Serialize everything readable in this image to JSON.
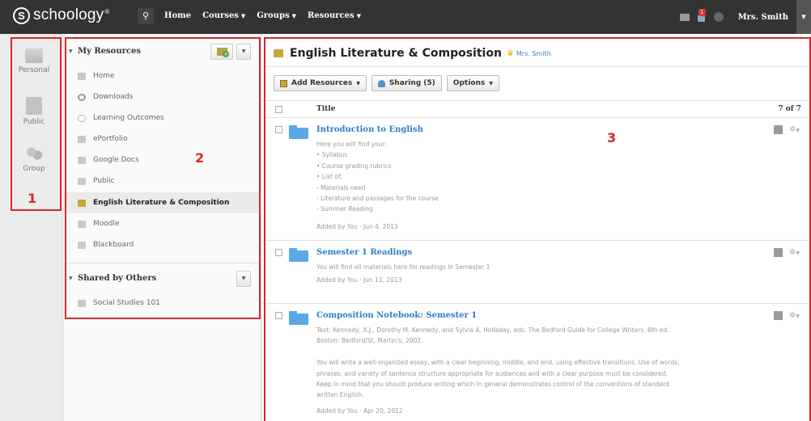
{
  "app": {
    "logo_letter": "S",
    "logo_text": "schoology",
    "logo_mark": "®"
  },
  "nav": {
    "items": [
      {
        "label": "Home",
        "has_caret": false
      },
      {
        "label": "Courses",
        "has_caret": true
      },
      {
        "label": "Groups",
        "has_caret": true
      },
      {
        "label": "Resources",
        "has_caret": true
      }
    ],
    "notification_count": "1",
    "user_name": "Mrs. Smith"
  },
  "categories": [
    {
      "label": "Personal",
      "icon": "personal-icon"
    },
    {
      "label": "Public",
      "icon": "public-icon"
    },
    {
      "label": "Group",
      "icon": "group-icon"
    }
  ],
  "tree": {
    "my_resources_title": "My Resources",
    "shared_title": "Shared by Others",
    "items": [
      {
        "label": "Home",
        "icon": "folder-icon"
      },
      {
        "label": "Downloads",
        "icon": "download-icon"
      },
      {
        "label": "Learning Outcomes",
        "icon": "outcomes-icon"
      },
      {
        "label": "ePortfolio",
        "icon": "portfolio-icon"
      },
      {
        "label": "Google Docs",
        "icon": "google-docs-icon"
      },
      {
        "label": "Public",
        "icon": "public-icon"
      },
      {
        "label": "English Literature & Composition",
        "icon": "collection-icon",
        "active": true
      },
      {
        "label": "Moodle",
        "icon": "folder-icon"
      },
      {
        "label": "Blackboard",
        "icon": "folder-icon"
      }
    ],
    "shared_items": [
      {
        "label": "Social Studies 101",
        "icon": "folder-icon"
      }
    ]
  },
  "main": {
    "title": "English Literature & Composition",
    "owner": "Mrs. Smith",
    "buttons": {
      "add_resources": "Add Resources",
      "sharing": "Sharing (5)",
      "options": "Options"
    },
    "column_title": "Title",
    "count": "7 of 7",
    "rows": [
      {
        "title": "Introduction to English",
        "desc_lines": [
          "Here you will find your:",
          "• Syllabus",
          "• Course grading rubrics",
          "• List of:",
          "- Materials need",
          "- Literature and passages for the course",
          "- Summer Reading"
        ],
        "added": "Added by You · Jun 4, 2013"
      },
      {
        "title": "Semester 1 Readings",
        "desc_lines": [
          "You will find all materials here for readings in Semester 1"
        ],
        "added": "Added by You · Jun 11, 2013"
      },
      {
        "title": "Composition Notebook: Semester 1",
        "desc_lines": [
          "Text: Kennedy, X.J., Dorothy M. Kennedy, and Sylvia A. Holladay, eds. The Bedford Guide for College Writers. 6th ed.",
          "Boston: Bedford/St. Martin's, 2002.",
          "",
          "You will write a well-organized essay, with a clear beginning, middle, and end, using effective transitions. Use of words,",
          "phrases, and variety of sentence structure appropriate for audiences and with a clear purpose must be considered.",
          "Keep in mind that you should produce writing which in general demonstrates control of the conventions of standard",
          "written English."
        ],
        "added": "Added by You · Apr 20, 2012"
      }
    ]
  },
  "annotations": {
    "one": "1",
    "two": "2",
    "three": "3",
    "color": "#d7282c"
  },
  "colors": {
    "topbar": "#333333",
    "link": "#2f7dc4",
    "folder": "#5aa9e6",
    "gold": "#c9a53b"
  }
}
